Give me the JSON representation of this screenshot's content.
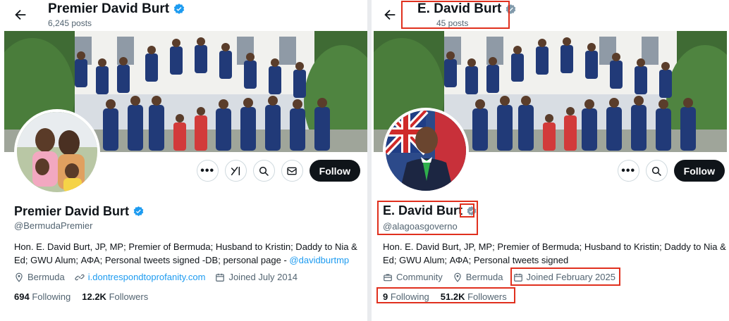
{
  "left": {
    "header_title": "Premier David Burt",
    "header_posts": "6,245 posts",
    "name": "Premier David Burt",
    "handle": "@BermudaPremier",
    "bio": "Hon. E. David Burt, JP, MP; Premier of Bermuda; Husband to Kristin; Daddy to Nia & Ed; GWU Alum; ΑΦΑ; Personal tweets signed -DB; personal page - ",
    "bio_link": "@davidburtmp",
    "location": "Bermuda",
    "website": "i.dontrespondtoprofanity.com",
    "joined": "Joined July 2014",
    "following_count": "694",
    "following_label": "Following",
    "followers_count": "12.2K",
    "followers_label": "Followers",
    "follow_button": "Follow",
    "verified_color": "#1d9bf0"
  },
  "right": {
    "header_title": "E. David Burt",
    "header_posts": "45 posts",
    "name": "E. David Burt",
    "handle": "@alagoasgoverno",
    "bio": "Hon. E. David Burt, JP, MP; Premier of Bermuda; Husband to Kristin; Daddy to Nia & Ed; GWU Alum; ΑΦΑ; Personal tweets signed",
    "category": "Community",
    "location": "Bermuda",
    "joined": "Joined February 2025",
    "following_count": "9",
    "following_label": "Following",
    "followers_count": "51.2K",
    "followers_label": "Followers",
    "follow_button": "Follow",
    "verified_color": "#829aab"
  },
  "colors": {
    "highlight": "#e0301e",
    "link": "#1d9bf0",
    "muted": "#536471"
  },
  "icons": [
    "back-arrow-icon",
    "verified-badge-icon",
    "more-icon",
    "grok-icon",
    "search-icon",
    "message-icon",
    "location-icon",
    "link-icon",
    "calendar-icon",
    "briefcase-icon"
  ]
}
